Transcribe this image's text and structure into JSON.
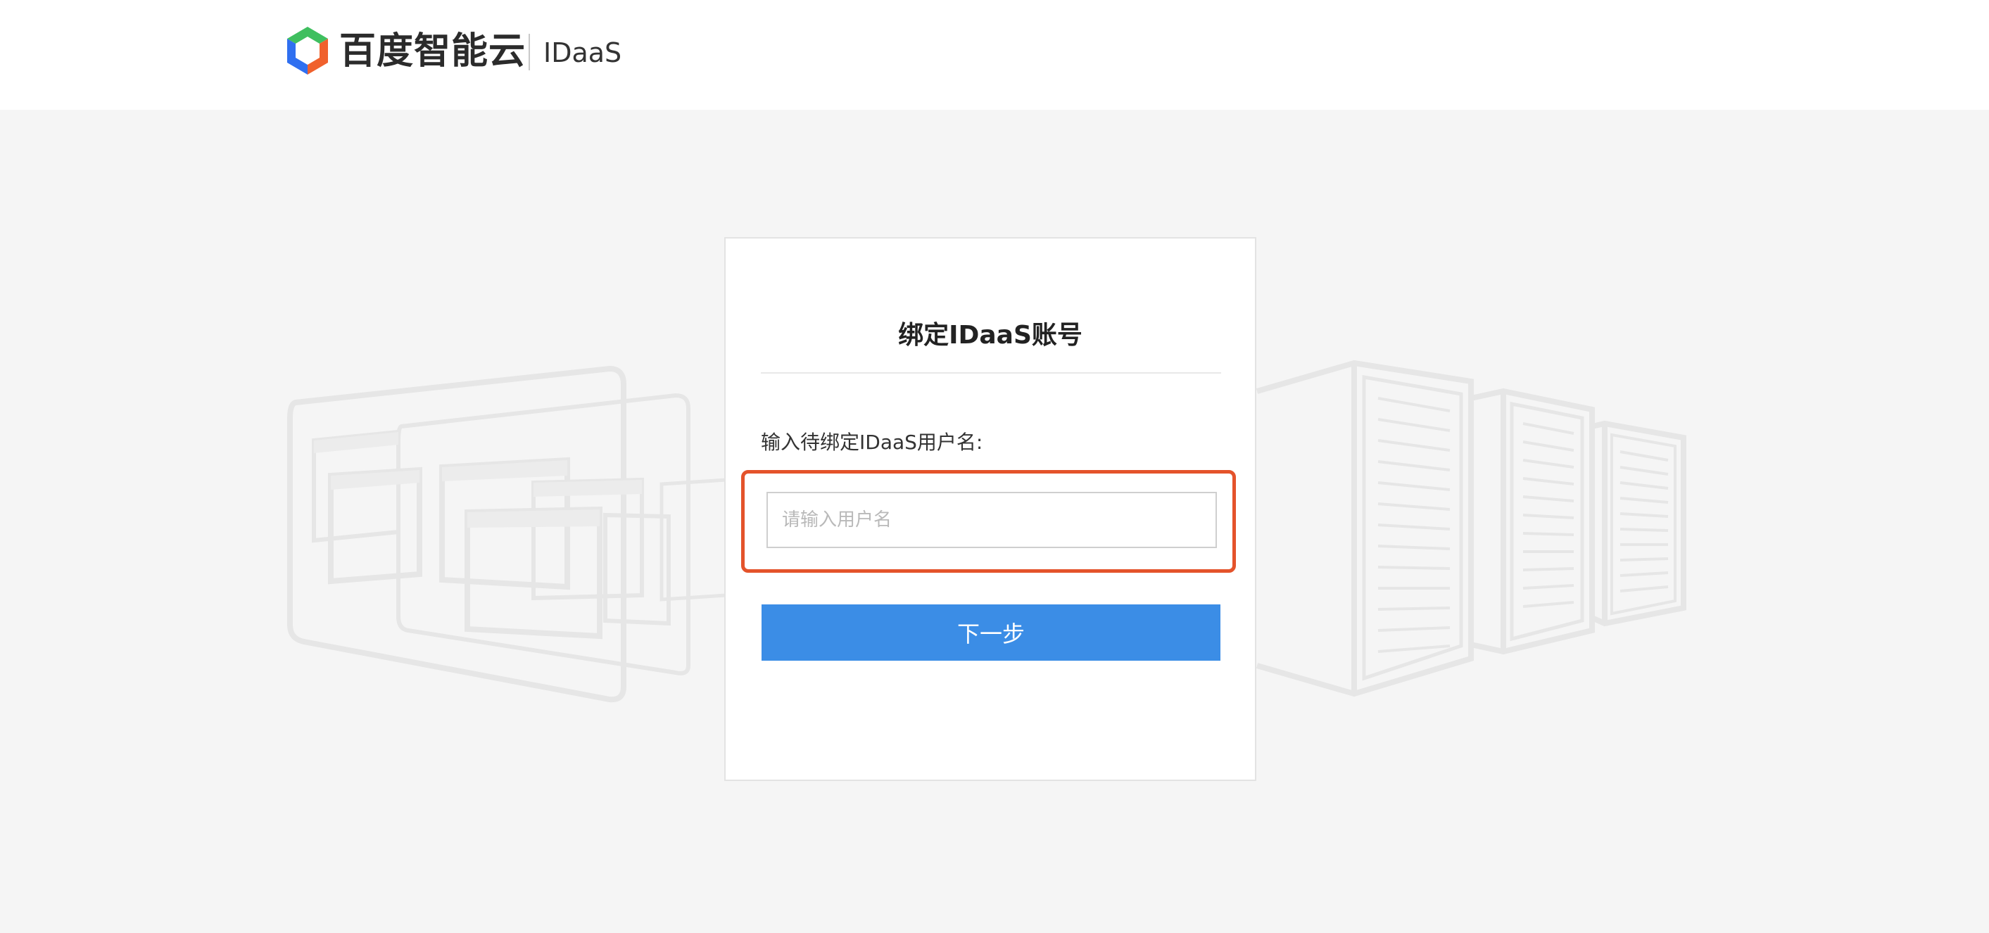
{
  "header": {
    "logo_icon": "baidu-ai-cloud-hexagon-logo",
    "brand_name": "百度智能云",
    "product_name": "IDaaS"
  },
  "card": {
    "title": "绑定IDaaS账号",
    "username_label": "输入待绑定IDaaS用户名:",
    "username_value": "",
    "username_placeholder": "请输入用户名",
    "next_button_label": "下一步"
  },
  "colors": {
    "primary_button": "#3b8de6",
    "highlight_border": "#e4532b",
    "page_background": "#f5f5f5",
    "logo_green": "#3fbf5f",
    "logo_blue": "#2f6ff0",
    "logo_orange": "#f0612d"
  }
}
